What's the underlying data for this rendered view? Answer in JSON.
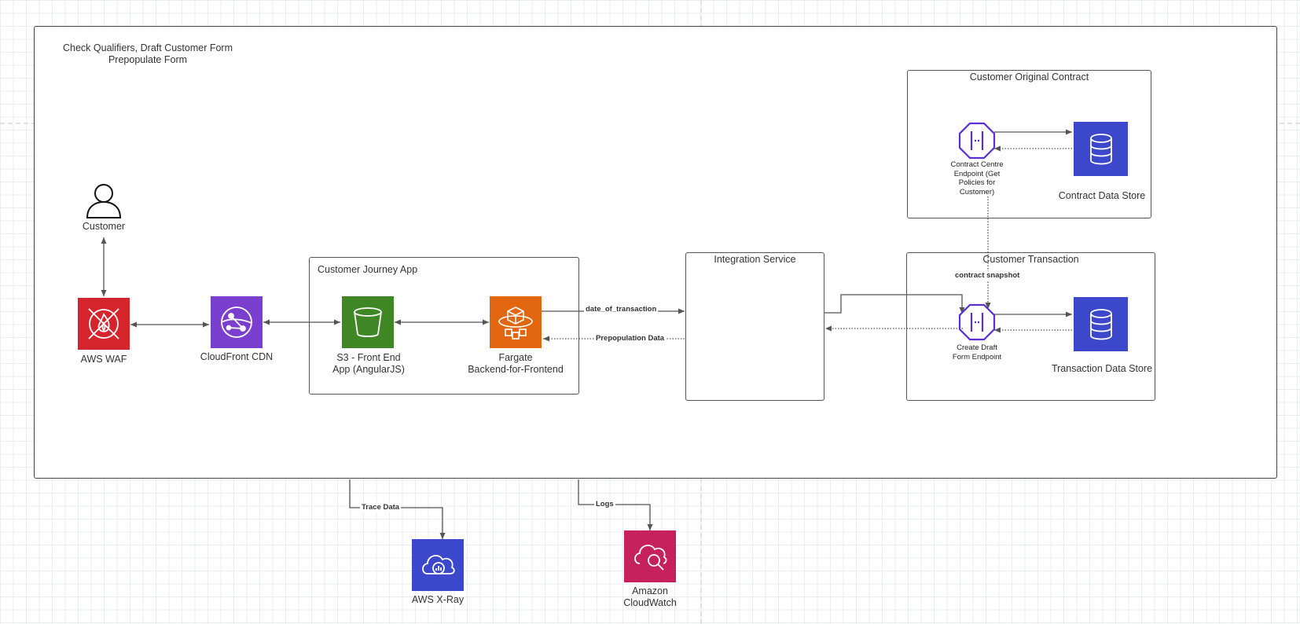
{
  "diagram": {
    "outer_title": [
      "Check Qualifiers, Draft Customer Form",
      "Prepopulate Form"
    ],
    "groups": {
      "customer_journey_app": "Customer Journey App",
      "integration_service": "Integration Service",
      "customer_original_contract": "Customer Original Contract",
      "customer_transaction": "Customer Transaction"
    },
    "nodes": {
      "customer": "Customer",
      "aws_waf": "AWS WAF",
      "cloudfront": "CloudFront CDN",
      "s3": [
        "S3 - Front End",
        "App (AngularJS)"
      ],
      "fargate": [
        "Fargate",
        "Backend-for-Frontend"
      ],
      "contract_endpoint": [
        "Contract Centre",
        "Endpoint (Get",
        "Policies for",
        "Customer)"
      ],
      "contract_store": "Contract Data Store",
      "draft_endpoint": [
        "Create Draft",
        "Form Endpoint"
      ],
      "transaction_store": "Transaction Data Store",
      "xray": "AWS X-Ray",
      "cloudwatch": [
        "Amazon",
        "CloudWatch"
      ]
    },
    "edges": {
      "date_of_transaction": "date_of_transaction",
      "prepopulation_data": "Prepopulation Data",
      "contract_snapshot": "contract snapshot",
      "trace_data": "Trace Data",
      "logs": "Logs"
    },
    "colors": {
      "waf": "#D6242D",
      "cloudfront": "#7B3FD0",
      "s3": "#3F8624",
      "fargate": "#E2650F",
      "database": "#3B48CC",
      "xray": "#3B48CC",
      "cloudwatch": "#C7215D",
      "api_gateway": "#5A2FD6"
    }
  }
}
